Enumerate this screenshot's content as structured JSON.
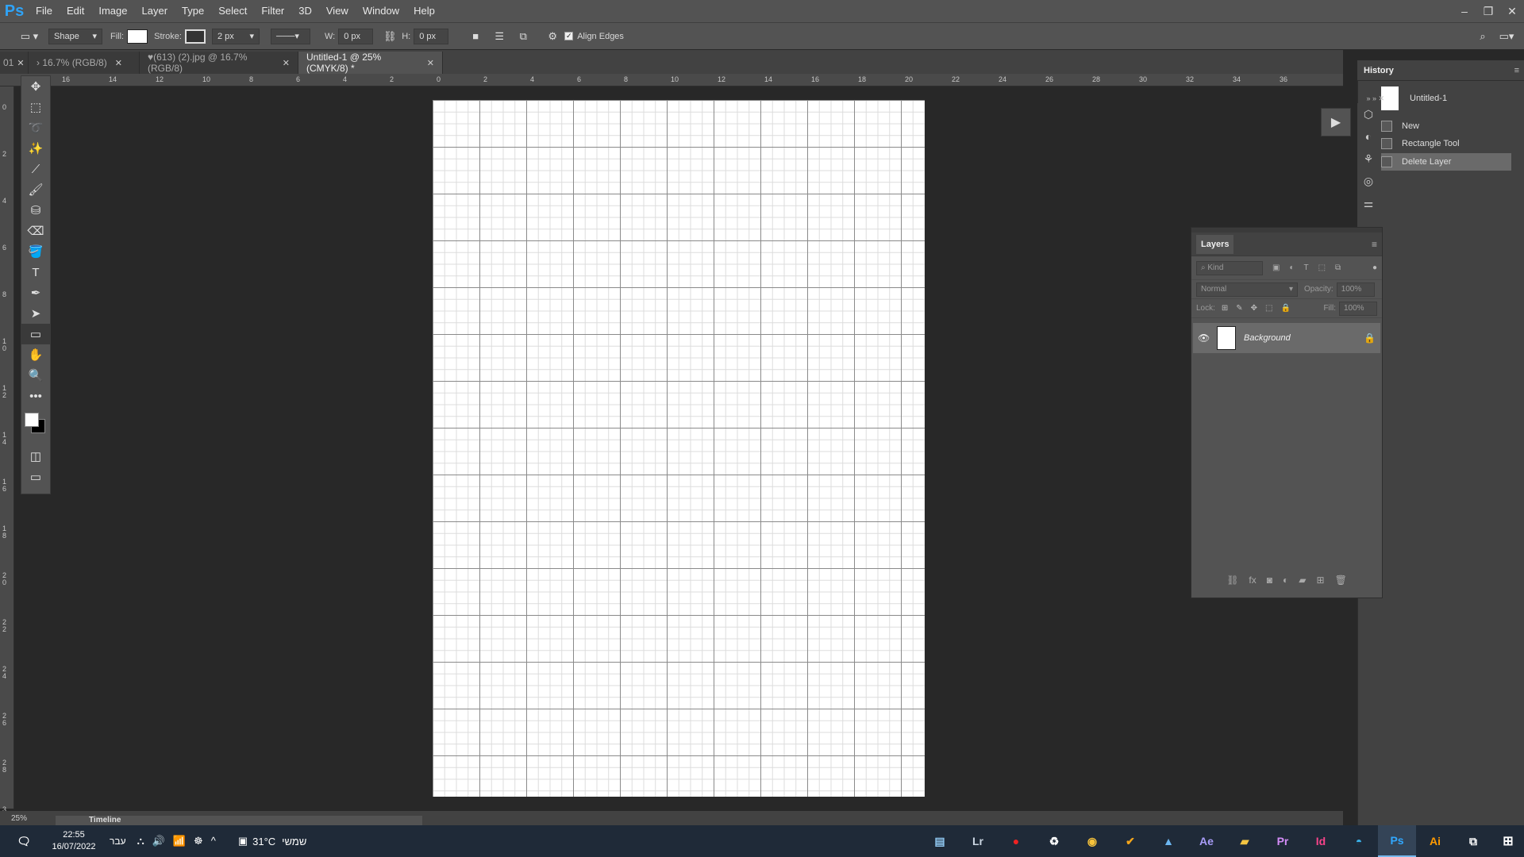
{
  "app": {
    "logo": "Ps"
  },
  "menu": [
    "File",
    "Edit",
    "Image",
    "Layer",
    "Type",
    "Select",
    "Filter",
    "3D",
    "View",
    "Window",
    "Help"
  ],
  "window_buttons": [
    "–",
    "❐",
    "✕"
  ],
  "options": {
    "tool_mode": "Shape",
    "fill_label": "Fill:",
    "stroke_label": "Stroke:",
    "stroke_width": "2 px",
    "w_label": "W:",
    "w_value": "0 px",
    "h_label": "H:",
    "h_value": "0 px",
    "align_edges": "Align Edges"
  },
  "tabs": [
    {
      "label": "01",
      "close": "✕"
    },
    {
      "label": "› 16.7% (RGB/8)",
      "close": "✕"
    },
    {
      "label": "♥(613) (2).jpg @ 16.7% (RGB/8)",
      "close": "✕"
    },
    {
      "label": "Untitled-1 @ 25% (CMYK/8) *",
      "close": "✕",
      "active": true
    }
  ],
  "hruler_ticks": [
    "16",
    "14",
    "12",
    "10",
    "8",
    "6",
    "4",
    "2",
    "0",
    "2",
    "4",
    "6",
    "8",
    "10",
    "12",
    "14",
    "16",
    "18",
    "20",
    "22",
    "24",
    "26",
    "28",
    "30",
    "32",
    "34",
    "36"
  ],
  "vruler_ticks": [
    "0",
    "2",
    "4",
    "6",
    "8",
    "1 0",
    "1 2",
    "1 4",
    "1 6",
    "1 8",
    "2 0",
    "2 2",
    "2 4",
    "2 6",
    "2 8",
    "3"
  ],
  "tools": [
    "✥",
    "⬚",
    "➰",
    "✨",
    "⟋",
    "🖌",
    "⛁",
    "⌫",
    "🪣",
    "T",
    "✒",
    "➤",
    "▭",
    "✋",
    "🔍",
    "•••"
  ],
  "history": {
    "title": "History",
    "snapshot": "Untitled-1",
    "items": [
      "New",
      "Rectangle Tool",
      "Delete Layer"
    ]
  },
  "layers": {
    "title": "Layers",
    "kind": "Kind",
    "blend": "Normal",
    "opacity_label": "Opacity:",
    "opacity_value": "100%",
    "lock_label": "Lock:",
    "fill_label": "Fill:",
    "fill_value": "100%",
    "layer_name": "Background"
  },
  "status": {
    "zoom": "25%",
    "timeline": "Timeline"
  },
  "taskbar": {
    "time": "22:55",
    "date": "16/07/2022",
    "lang": "עבר",
    "temp": "31°C",
    "weather": "שמשי",
    "apps": [
      "Lr",
      "●",
      "Ae",
      "Pr",
      "Id",
      "Ps",
      "Ai"
    ]
  }
}
